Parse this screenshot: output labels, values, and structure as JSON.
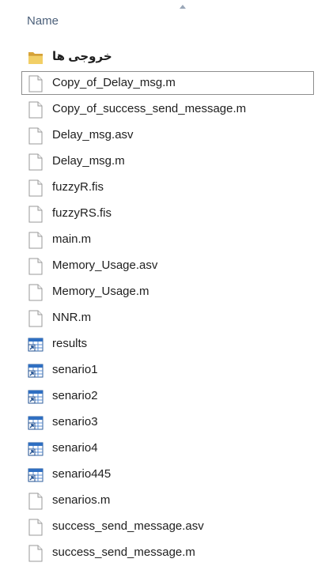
{
  "header": {
    "name_label": "Name"
  },
  "files": [
    {
      "name": "خروجی ها",
      "icon": "folder-icon",
      "selected": false
    },
    {
      "name": "Copy_of_Delay_msg.m",
      "icon": "file-icon",
      "selected": true
    },
    {
      "name": "Copy_of_success_send_message.m",
      "icon": "file-icon",
      "selected": false
    },
    {
      "name": "Delay_msg.asv",
      "icon": "file-icon",
      "selected": false
    },
    {
      "name": "Delay_msg.m",
      "icon": "file-icon",
      "selected": false
    },
    {
      "name": "fuzzyR.fis",
      "icon": "file-icon",
      "selected": false
    },
    {
      "name": "fuzzyRS.fis",
      "icon": "file-icon",
      "selected": false
    },
    {
      "name": "main.m",
      "icon": "file-icon",
      "selected": false
    },
    {
      "name": "Memory_Usage.asv",
      "icon": "file-icon",
      "selected": false
    },
    {
      "name": "Memory_Usage.m",
      "icon": "file-icon",
      "selected": false
    },
    {
      "name": "NNR.m",
      "icon": "file-icon",
      "selected": false
    },
    {
      "name": "results",
      "icon": "data-shortcut-icon",
      "selected": false
    },
    {
      "name": "senario1",
      "icon": "data-shortcut-icon",
      "selected": false
    },
    {
      "name": "senario2",
      "icon": "data-shortcut-icon",
      "selected": false
    },
    {
      "name": "senario3",
      "icon": "data-shortcut-icon",
      "selected": false
    },
    {
      "name": "senario4",
      "icon": "data-shortcut-icon",
      "selected": false
    },
    {
      "name": "senario445",
      "icon": "data-shortcut-icon",
      "selected": false
    },
    {
      "name": "senarios.m",
      "icon": "file-icon",
      "selected": false
    },
    {
      "name": "success_send_message.asv",
      "icon": "file-icon",
      "selected": false
    },
    {
      "name": "success_send_message.m",
      "icon": "file-icon",
      "selected": false
    }
  ]
}
